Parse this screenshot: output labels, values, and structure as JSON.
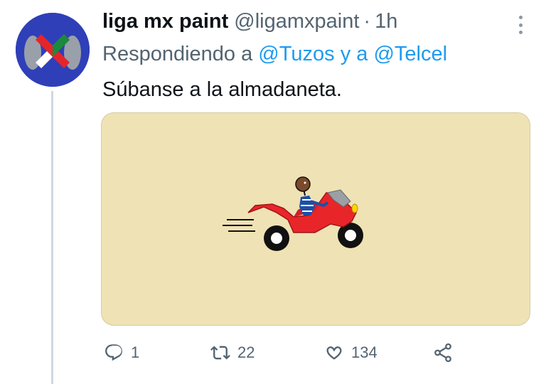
{
  "tweet": {
    "author_name": "liga mx paint",
    "author_handle": "@ligamxpaint",
    "separator": "·",
    "time": "1h",
    "replying_prefix": "Respondiendo a",
    "replying_user1": "@Tuzos",
    "replying_conj": "y a",
    "replying_user2": "@Telcel",
    "text": "Súbanse a la almadaneta.",
    "media_description_icon": "motorcycle-rider-drawing"
  },
  "actions": {
    "reply_count": "1",
    "retweet_count": "22",
    "like_count": "134"
  },
  "colors": {
    "link": "#1d9bf0",
    "secondary_text": "#536471",
    "media_bg": "#efe2b4",
    "avatar_bg": "#2f3fb8"
  },
  "icons": {
    "reply": "reply-icon",
    "retweet": "retweet-icon",
    "like": "heart-icon",
    "share": "share-icon",
    "more": "more-options-icon"
  }
}
